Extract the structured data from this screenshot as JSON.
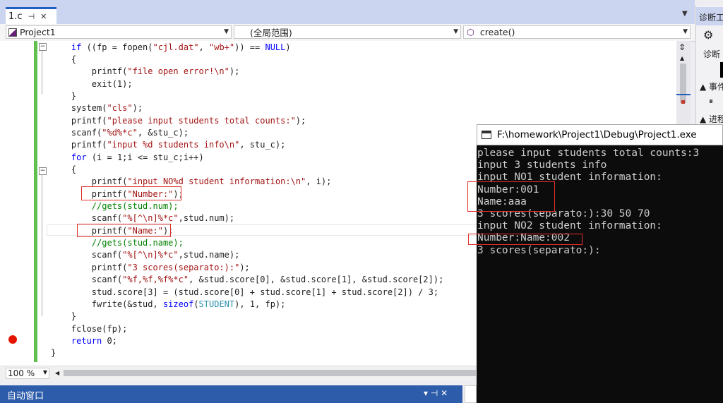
{
  "tab": {
    "name": "1.c",
    "pin_glyph": "⊣",
    "close_glyph": "✕"
  },
  "navbar": {
    "project": "Project1",
    "scope": "(全局范围)",
    "function": "create()"
  },
  "diagnostics": {
    "title": "诊断工",
    "label1": "诊断",
    "events": "▲ 事件",
    "pause": "⏸",
    "process": "▲ 进程"
  },
  "code_lines": [
    [
      "    ",
      {
        "k": "if"
      },
      " ((fp = fopen(",
      {
        "s": "\"cjl.dat\""
      },
      ", ",
      {
        "s": "\"wb+\""
      },
      ")) == ",
      {
        "k": "NULL"
      },
      ")"
    ],
    [
      "    {"
    ],
    [
      "        printf(",
      {
        "s": "\"file open error!\\n\""
      },
      ");"
    ],
    [
      "        exit(1);"
    ],
    [
      "    }"
    ],
    [
      "    system(",
      {
        "s": "\"cls\""
      },
      ");"
    ],
    [
      "    printf(",
      {
        "s": "\"please input students total counts:\""
      },
      ");"
    ],
    [
      "    scanf(",
      {
        "s": "\"%d%*c\""
      },
      ", &stu_c);"
    ],
    [
      "    printf(",
      {
        "s": "\"input %d students info\\n\""
      },
      ", stu_c);"
    ],
    [
      "    ",
      {
        "k": "for"
      },
      " (i = 1;i <= stu_c;i++)"
    ],
    [
      "    {"
    ],
    [
      "        printf(",
      {
        "s": "\"input NO%d student information:\\n\""
      },
      ", i);"
    ],
    [
      "        printf(",
      {
        "s": "\"Number:\""
      },
      ");"
    ],
    [
      "        ",
      {
        "c": "//gets(stud.num);"
      }
    ],
    [
      "        scanf(",
      {
        "s": "\"%[^\\n]%*c\""
      },
      ",stud.num);"
    ],
    [
      "        printf(",
      {
        "s": "\"Name:\""
      },
      ");"
    ],
    [
      "        ",
      {
        "c": "//gets(stud.name);"
      }
    ],
    [
      "        scanf(",
      {
        "s": "\"%[^\\n]%*c\""
      },
      ",stud.name);"
    ],
    [
      "        printf(",
      {
        "s": "\"3 scores(separato:):\""
      },
      ");"
    ],
    [
      "        scanf(",
      {
        "s": "\"%f,%f,%f%*c\""
      },
      ", &stud.score[0], &stud.score[1], &stud.score[2]);"
    ],
    [
      "        stud.score[3] = (stud.score[0] + stud.score[1] + stud.score[2]) / 3;"
    ],
    [
      "        fwrite(&stud, ",
      {
        "k": "sizeof"
      },
      "(",
      {
        "t": "STUDENT"
      },
      "), 1, fp);"
    ],
    [
      "    }"
    ],
    [
      "    fclose(fp);"
    ],
    [
      "    ",
      {
        "k": "return"
      },
      " 0;"
    ],
    [
      "}"
    ]
  ],
  "zoom": {
    "level": "100 %"
  },
  "auto_window": {
    "title": "自动窗口",
    "controls": "▾ ⊣ ✕"
  },
  "console": {
    "title": "F:\\homework\\Project1\\Debug\\Project1.exe",
    "lines": [
      "please input students total counts:3",
      "input 3 students info",
      "input NO1 student information:",
      "Number:001",
      "Name:aaa",
      "3 scores(separato:):30 50 70",
      "input NO2 student information:",
      "Number:Name:002",
      "3 scores(separato:):"
    ]
  },
  "colors": {
    "accent": "#2d5cab",
    "breakpoint": "#e51400",
    "changebar": "#61c04d",
    "annotation": "#e0302a"
  }
}
